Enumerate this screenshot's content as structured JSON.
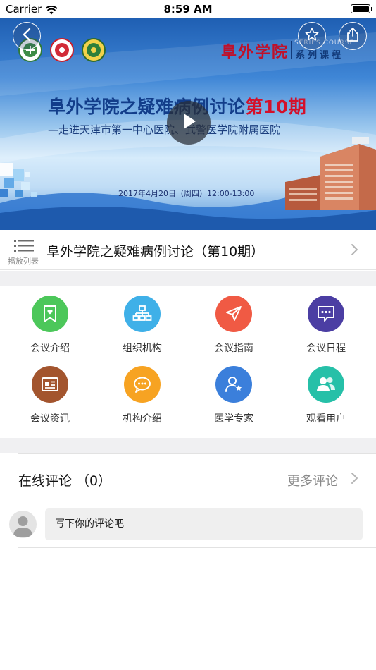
{
  "status_bar": {
    "carrier": "Carrier",
    "time": "8:59 AM"
  },
  "banner": {
    "brand": "阜外学院",
    "series_en": "SERIES COURSE",
    "series": "系列课程",
    "title_main": "阜外学院之疑难病例讨论",
    "title_accent": "第10期",
    "subtitle": "—走进天津市第一中心医院、武警医学院附属医院",
    "date": "2017年4月20日（周四）12:00-13:00"
  },
  "playlist": {
    "label": "播放列表",
    "title": "阜外学院之疑难病例讨论（第10期）"
  },
  "grid": {
    "items": [
      {
        "label": "会议介绍",
        "color": "#4cc75a",
        "icon": "bookmark-heart-icon"
      },
      {
        "label": "组织机构",
        "color": "#3fb0e8",
        "icon": "org-chart-icon"
      },
      {
        "label": "会议指南",
        "color": "#f05a44",
        "icon": "paper-plane-icon"
      },
      {
        "label": "会议日程",
        "color": "#4b3ea3",
        "icon": "chat-bubble-icon"
      },
      {
        "label": "会议资讯",
        "color": "#a3552e",
        "icon": "news-card-icon"
      },
      {
        "label": "机构介绍",
        "color": "#f7a322",
        "icon": "speech-bubble-icon"
      },
      {
        "label": "医学专家",
        "color": "#3b7fdb",
        "icon": "user-star-icon"
      },
      {
        "label": "观看用户",
        "color": "#26c0a8",
        "icon": "users-icon"
      }
    ]
  },
  "comments": {
    "title": "在线评论 （0）",
    "more": "更多评论",
    "input_placeholder": "写下你的评论吧"
  }
}
